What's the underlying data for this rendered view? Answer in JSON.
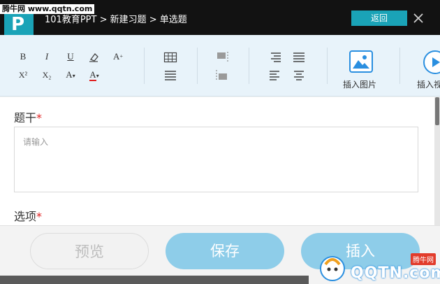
{
  "watermark_top": "腾牛网 www.qqtn.com",
  "app": {
    "logo_letter": "P"
  },
  "breadcrumb": "101教育PPT > 新建习题 > 单选题",
  "header": {
    "back_label": "返回",
    "close_glyph": "✕"
  },
  "toolbar": {
    "format": {
      "bold": "B",
      "italic": "I",
      "underline": "U",
      "font_size_up": "A",
      "superscript": "X²",
      "subscript": "X₂",
      "font_size": "A",
      "font_color": "A",
      "font_color_value": "#e02020"
    },
    "insert_image_label": "插入图片",
    "insert_video_label": "插入视"
  },
  "form": {
    "stem_label": "题干",
    "stem_placeholder": "请输入",
    "options_label": "选项",
    "required_mark": "*"
  },
  "footer": {
    "preview_label": "预览",
    "save_label": "保存",
    "insert_label": "插入"
  },
  "watermark_logo": {
    "text": "QQTN.com",
    "tag": "腾牛网"
  },
  "colors": {
    "accent": "#1aa3b7",
    "button_blue": "#8ecde9",
    "required": "#e02020",
    "toolbar_bg": "#e8f3fa"
  }
}
